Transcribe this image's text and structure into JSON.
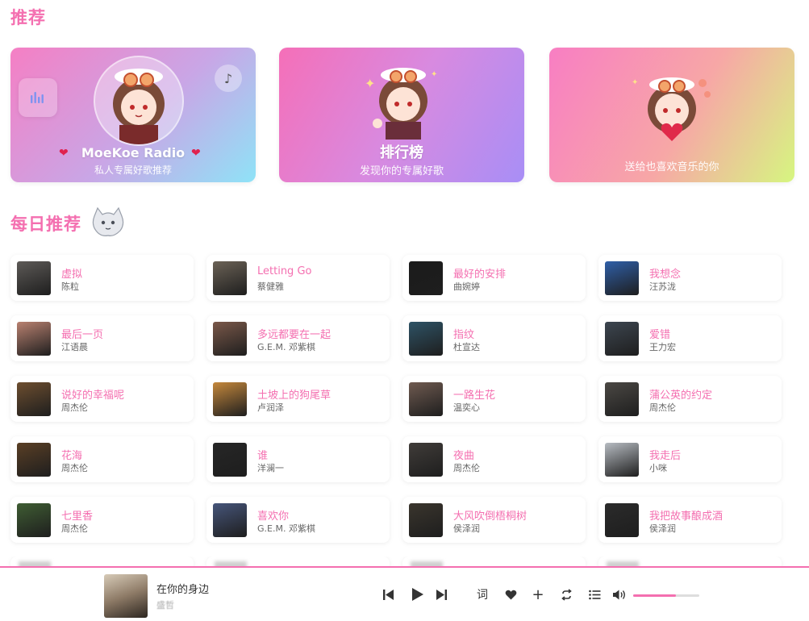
{
  "sections": {
    "recommend_title": "推荐",
    "daily_title": "每日推荐"
  },
  "cards": [
    {
      "title": "MoeKoe Radio",
      "subtitle": "私人专属好歌推荐"
    },
    {
      "title": "排行榜",
      "subtitle": "发现你的专属好歌"
    },
    {
      "title": "",
      "subtitle": "送给也喜欢音乐的你"
    }
  ],
  "songs": [
    {
      "name": "虚拟",
      "artist": "陈粒",
      "cover": "#5d5a57"
    },
    {
      "name": "Letting Go",
      "artist": "蔡健雅",
      "cover": "#6b6256"
    },
    {
      "name": "最好的安排",
      "artist": "曲婉婷",
      "cover": "#1b1b1b"
    },
    {
      "name": "我想念",
      "artist": "汪苏泷",
      "cover": "#2f5fa8"
    },
    {
      "name": "最后一页",
      "artist": "江语晨",
      "cover": "#b98170"
    },
    {
      "name": "多远都要在一起",
      "artist": "G.E.M. 邓紫棋",
      "cover": "#7a5849"
    },
    {
      "name": "指纹",
      "artist": "杜宣达",
      "cover": "#2e5366"
    },
    {
      "name": "爱错",
      "artist": "王力宏",
      "cover": "#3d4650"
    },
    {
      "name": "说好的幸福呢",
      "artist": "周杰伦",
      "cover": "#6d4e2f"
    },
    {
      "name": "土坡上的狗尾草",
      "artist": "卢润泽",
      "cover": "#c5883c"
    },
    {
      "name": "一路生花",
      "artist": "温奕心",
      "cover": "#6f5a50"
    },
    {
      "name": "蒲公英的约定",
      "artist": "周杰伦",
      "cover": "#4b4844"
    },
    {
      "name": "花海",
      "artist": "周杰伦",
      "cover": "#5a3f25"
    },
    {
      "name": "谁",
      "artist": "洋澜一",
      "cover": "#262626"
    },
    {
      "name": "夜曲",
      "artist": "周杰伦",
      "cover": "#403c39"
    },
    {
      "name": "我走后",
      "artist": "小咪",
      "cover": "#b7bcc2"
    },
    {
      "name": "七里香",
      "artist": "周杰伦",
      "cover": "#3f5d33"
    },
    {
      "name": "喜欢你",
      "artist": "G.E.M. 邓紫棋",
      "cover": "#46557a"
    },
    {
      "name": "大风吹倒梧桐树",
      "artist": "侯泽润",
      "cover": "#3a352d"
    },
    {
      "name": "我把故事酿成酒",
      "artist": "侯泽润",
      "cover": "#2b2b2b"
    }
  ],
  "player": {
    "title": "在你的身边",
    "artist": "盛哲",
    "lyrics_label": "词",
    "volume": 0.65
  },
  "colors": {
    "accent": "#f46fb0"
  }
}
